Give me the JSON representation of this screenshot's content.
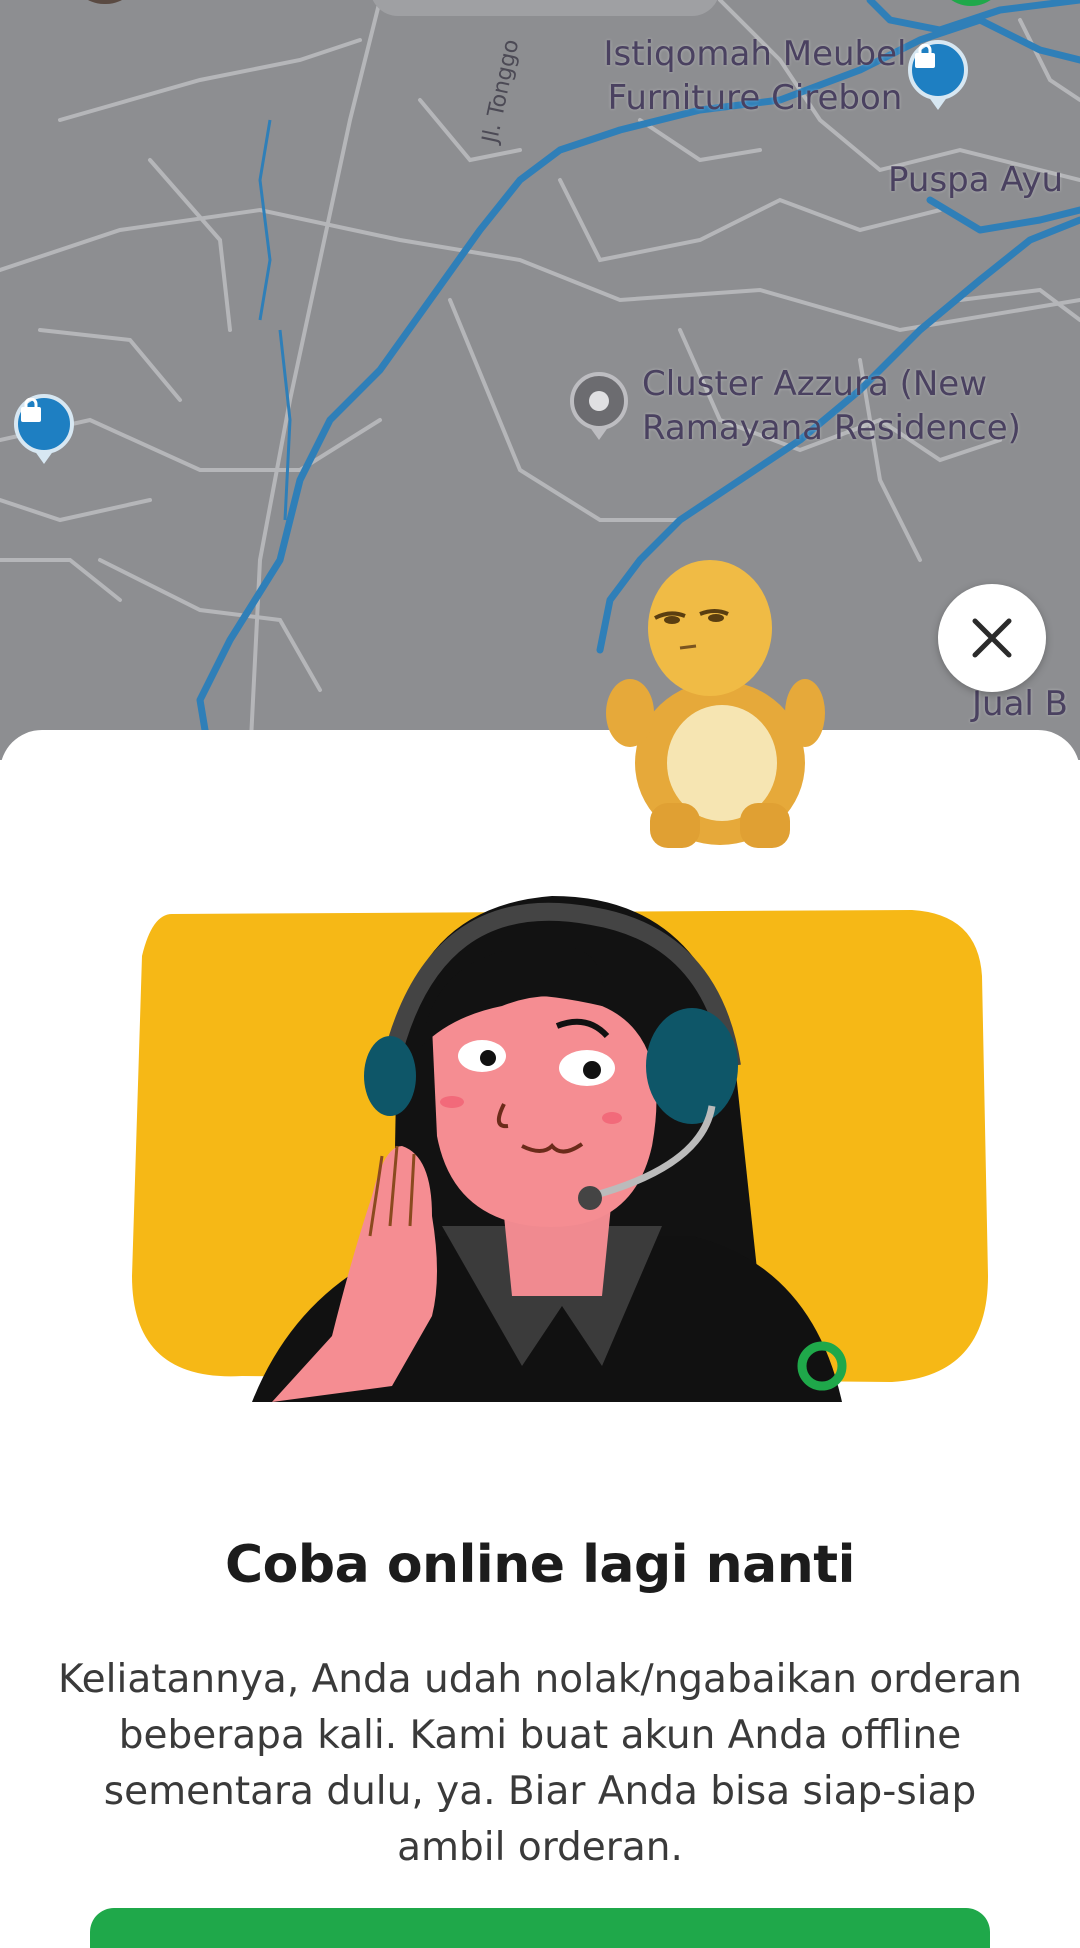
{
  "map": {
    "places": [
      {
        "name": "Istiqomah Meubel\nFurniture Cirebon"
      },
      {
        "name": "Puspa Ayu"
      },
      {
        "name": "Cluster Azzura (New\nRamayana Residence)"
      },
      {
        "name": "Jual B"
      }
    ],
    "street_label": "Jl. Tonggo",
    "colors": {
      "background": "#8d8e91",
      "roads": "#b6b7ba",
      "rivers": "#2f7fb8",
      "shop_pin": "#1e7fc2"
    }
  },
  "close_icon": "close-icon",
  "dialog": {
    "title": "Coba online lagi nanti",
    "message": "Keliatannya, Anda udah nolak/ngabaikan orderan beberapa kali. Kami buat akun Anda offline sementara dulu, ya. Biar Anda bisa siap-siap ambil orderan."
  },
  "colors": {
    "illustration_bg": "#f6b816",
    "brand_green": "#1fa84a"
  }
}
